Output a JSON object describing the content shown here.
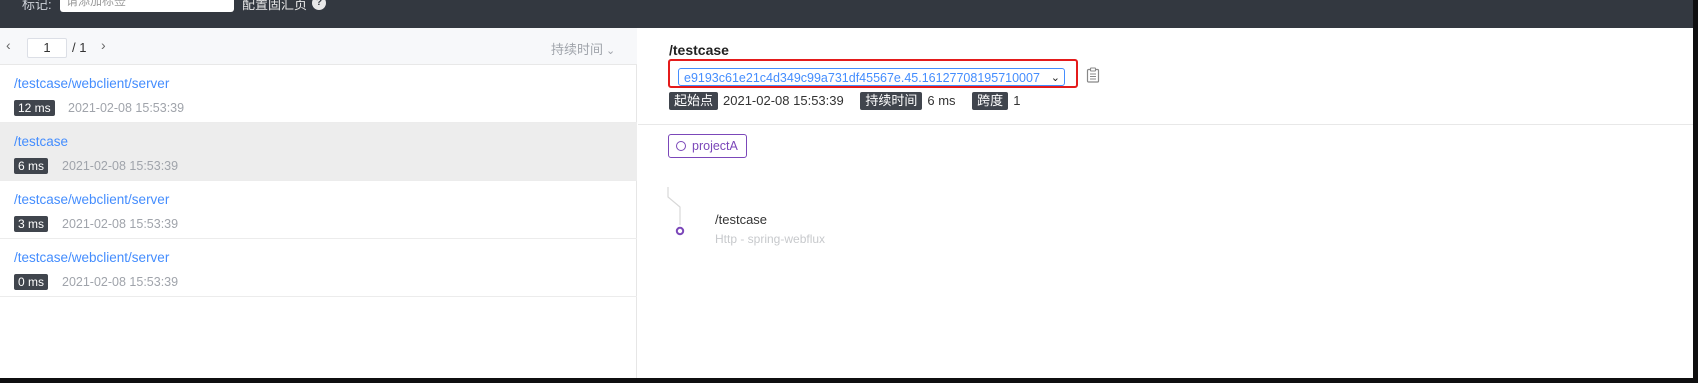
{
  "topbar": {
    "tag_label": "标记:",
    "tag_placeholder": "请添加标签",
    "config_link": "配置固汇页",
    "help_icon": "question-circle-icon"
  },
  "pager": {
    "page": "1",
    "total": "/ 1",
    "sort_label": "持续时间"
  },
  "traces": [
    {
      "endpoint": "/testcase/webclient/server",
      "duration": "12 ms",
      "time": "2021-02-08 15:53:39",
      "active": false
    },
    {
      "endpoint": "/testcase",
      "duration": "6 ms",
      "time": "2021-02-08 15:53:39",
      "active": true
    },
    {
      "endpoint": "/testcase/webclient/server",
      "duration": "3 ms",
      "time": "2021-02-08 15:53:39",
      "active": false
    },
    {
      "endpoint": "/testcase/webclient/server",
      "duration": "0 ms",
      "time": "2021-02-08 15:53:39",
      "active": false
    }
  ],
  "detail": {
    "title": "/testcase",
    "trace_id": "e9193c61e21c4d349c99a731df45567e.45.16127708195710007",
    "start_label": "起始点",
    "start_value": "2021-02-08 15:53:39",
    "duration_label": "持续时间",
    "duration_value": "6 ms",
    "span_label": "跨度",
    "span_value": "1"
  },
  "service": {
    "name": "projectA"
  },
  "span": {
    "name": "/testcase",
    "sub": "Http - spring-webflux"
  },
  "colors": {
    "accent_blue": "#448dfe",
    "service_purple": "#7b47b9",
    "highlight_red": "#e41b1b",
    "badge_dark": "#40454d"
  }
}
